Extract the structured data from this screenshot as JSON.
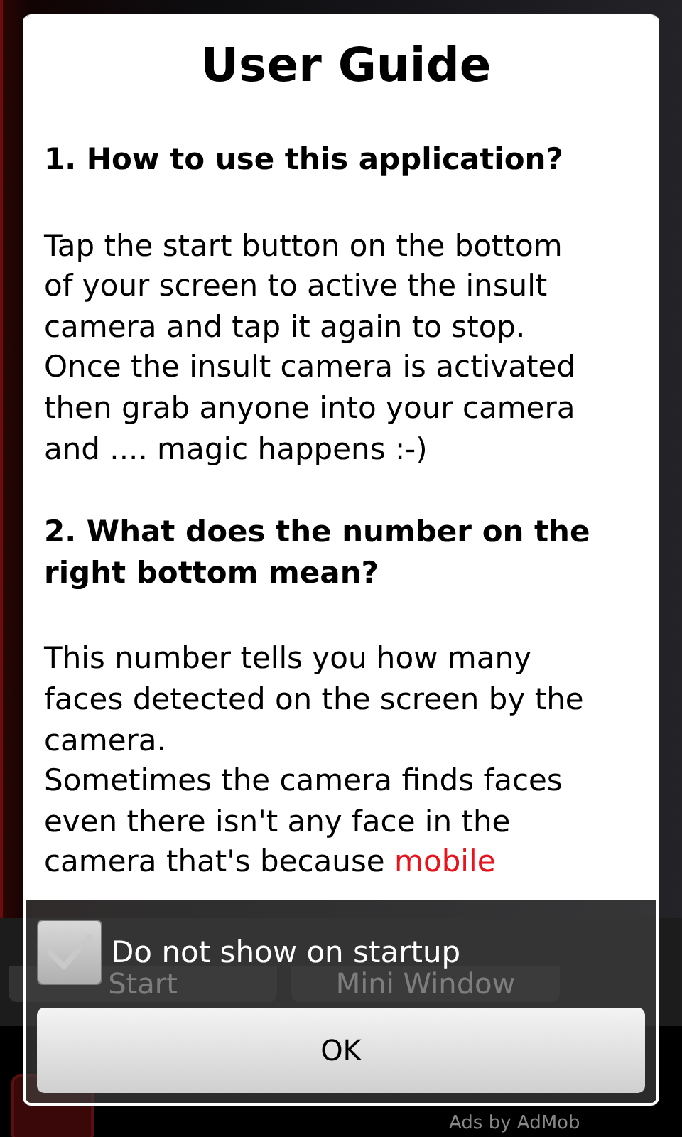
{
  "background": {
    "buttons": [
      "Start",
      "Mini Window"
    ],
    "ad_label": "Ads by AdMob"
  },
  "dialog": {
    "title": "User Guide",
    "sections": [
      {
        "kind": "heading",
        "parts": [
          {
            "text": "1. How to use this application?",
            "highlight": false
          }
        ]
      },
      {
        "kind": "paragraph",
        "parts": [
          {
            "text": "Tap the start button on the bottom\nof your screen to active the insult\ncamera and tap it again to stop.\nOnce the insult camera is activated\nthen grab anyone into your camera\nand .... magic happens :-)",
            "highlight": false
          }
        ]
      },
      {
        "kind": "heading",
        "parts": [
          {
            "text": "2. What does the number on the\nright bottom mean?",
            "highlight": false
          }
        ]
      },
      {
        "kind": "paragraph",
        "parts": [
          {
            "text": "This number tells you how many\nfaces detected on the screen by the\ncamera.\nSometimes the camera finds faces\neven there isn't any face in the\ncamera that's because ",
            "highlight": false
          },
          {
            "text": "mobile",
            "highlight": true
          }
        ]
      }
    ],
    "checkbox": {
      "label": "Do not show on startup",
      "checked": false
    },
    "button": "OK"
  }
}
